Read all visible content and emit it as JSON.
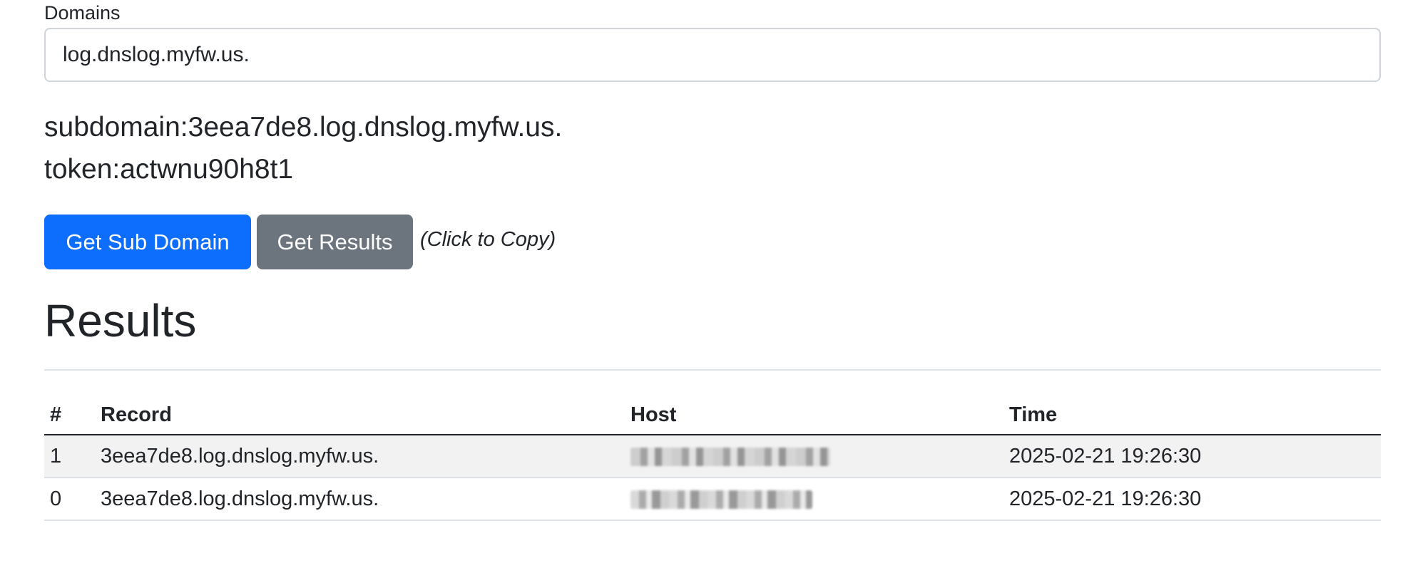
{
  "form": {
    "domains_label": "Domains",
    "domains_value": "log.dnslog.myfw.us."
  },
  "info": {
    "subdomain_line": "subdomain:3eea7de8.log.dnslog.myfw.us.",
    "token_line": "token:actwnu90h8t1"
  },
  "actions": {
    "get_sub_domain_label": "Get Sub Domain",
    "get_results_label": "Get Results",
    "copy_hint": "(Click to Copy)",
    "primary_color": "#0d6efd",
    "secondary_color": "#6c757d"
  },
  "results": {
    "title": "Results",
    "columns": [
      "#",
      "Record",
      "Host",
      "Time"
    ],
    "rows": [
      {
        "num": "1",
        "record": "3eea7de8.log.dnslog.myfw.us.",
        "host": "(redacted)",
        "time": "2025-02-21 19:26:30"
      },
      {
        "num": "0",
        "record": "3eea7de8.log.dnslog.myfw.us.",
        "host": "(redacted)",
        "time": "2025-02-21 19:26:30"
      }
    ]
  }
}
